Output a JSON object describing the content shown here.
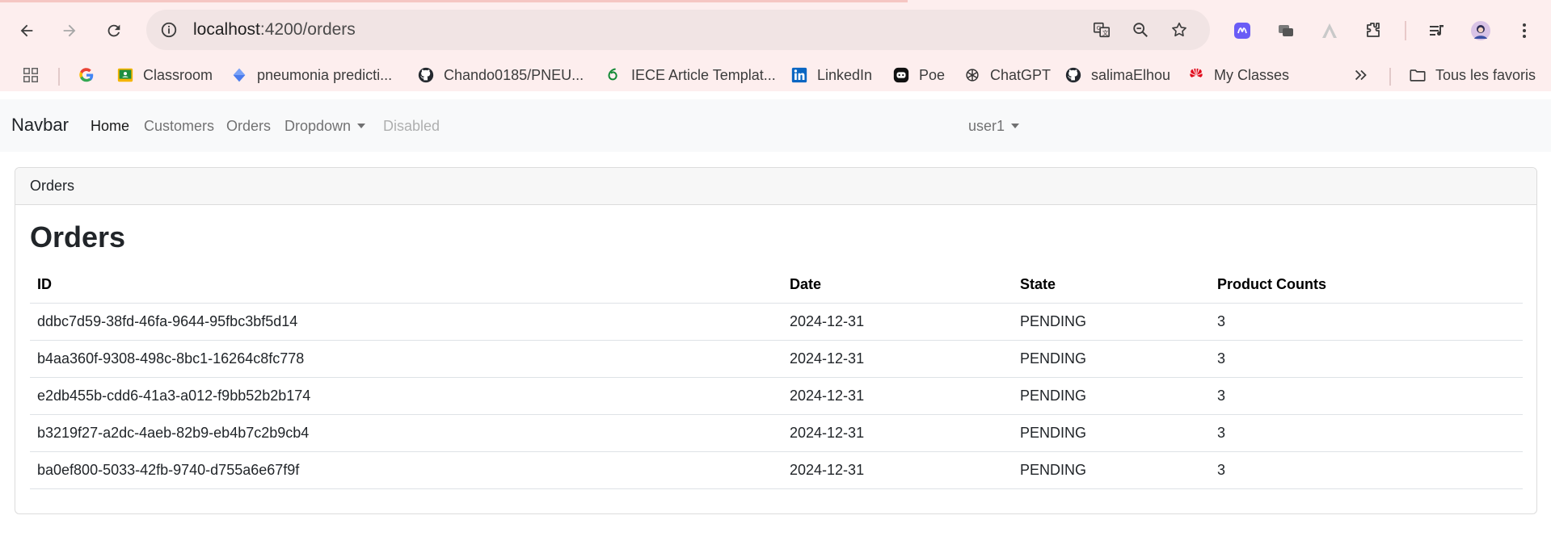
{
  "browser": {
    "url_host": "localhost",
    "url_rest": ":4200/orders",
    "bookmarks": [
      {
        "label": "",
        "icon": "google-icon"
      },
      {
        "label": "Classroom",
        "icon": "classroom-icon"
      },
      {
        "label": "pneumonia predicti...",
        "icon": "diamond-icon"
      },
      {
        "label": "Chando0185/PNEU...",
        "icon": "github-icon"
      },
      {
        "label": "IECE Article Templat...",
        "icon": "overleaf-icon"
      },
      {
        "label": "LinkedIn",
        "icon": "linkedin-icon"
      },
      {
        "label": "Poe",
        "icon": "poe-icon"
      },
      {
        "label": "ChatGPT",
        "icon": "chatgpt-icon"
      },
      {
        "label": "salimaElhou",
        "icon": "github-icon"
      },
      {
        "label": "My Classes",
        "icon": "huawei-icon"
      }
    ],
    "all_bookmarks_label": "Tous les favoris"
  },
  "navbar": {
    "brand": "Navbar",
    "links": [
      "Home",
      "Customers",
      "Orders",
      "Dropdown",
      "Disabled"
    ],
    "user": "user1"
  },
  "card": {
    "header": "Orders",
    "title": "Orders"
  },
  "table": {
    "columns": [
      "ID",
      "Date",
      "State",
      "Product Counts"
    ],
    "rows": [
      [
        "ddbc7d59-38fd-46fa-9644-95fbc3bf5d14",
        "2024-12-31",
        "PENDING",
        "3"
      ],
      [
        "b4aa360f-9308-498c-8bc1-16264c8fc778",
        "2024-12-31",
        "PENDING",
        "3"
      ],
      [
        "e2db455b-cdd6-41a3-a012-f9bb52b2b174",
        "2024-12-31",
        "PENDING",
        "3"
      ],
      [
        "b3219f27-a2dc-4aeb-82b9-eb4b7c2b9cb4",
        "2024-12-31",
        "PENDING",
        "3"
      ],
      [
        "ba0ef800-5033-42fb-9740-d755a6e67f9f",
        "2024-12-31",
        "PENDING",
        "3"
      ]
    ]
  }
}
